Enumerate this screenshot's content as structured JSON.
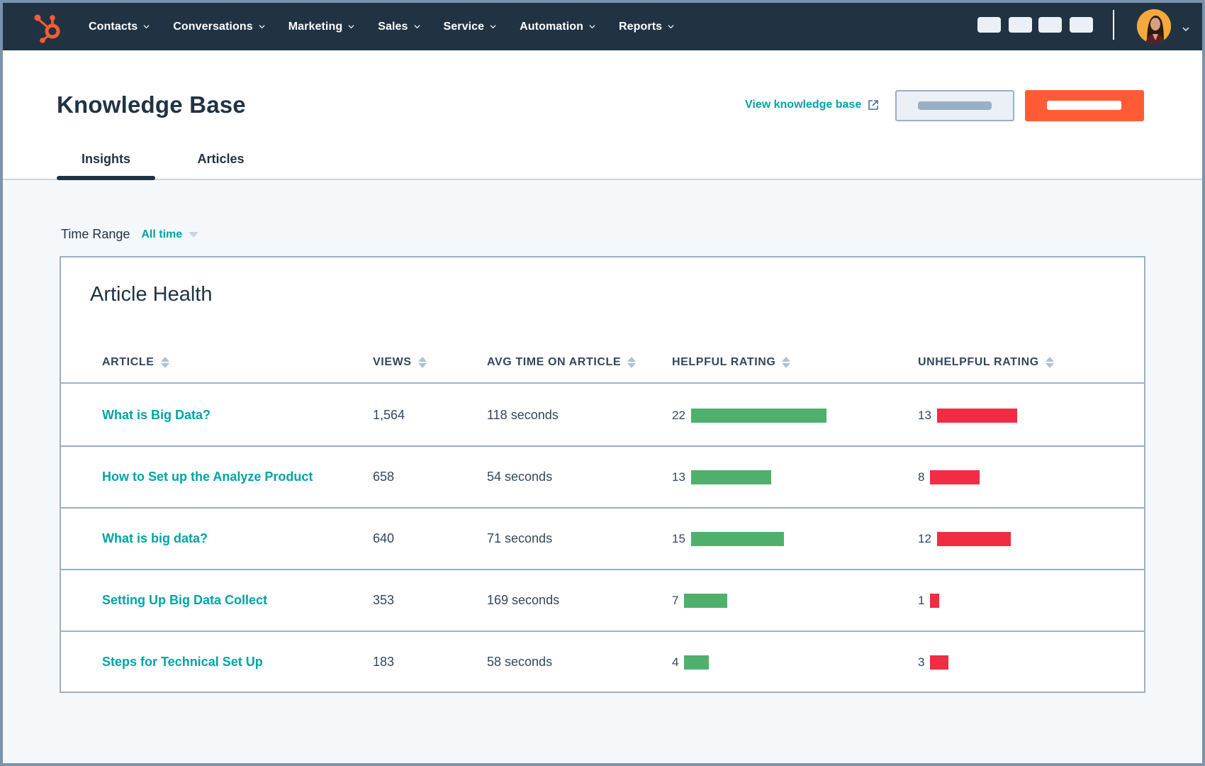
{
  "nav": {
    "logo": "hubspot-sprocket-logo",
    "items": [
      {
        "label": "Contacts"
      },
      {
        "label": "Conversations"
      },
      {
        "label": "Marketing"
      },
      {
        "label": "Sales"
      },
      {
        "label": "Service"
      },
      {
        "label": "Automation"
      },
      {
        "label": "Reports"
      }
    ],
    "avatar": "user-avatar"
  },
  "header": {
    "title": "Knowledge Base",
    "view_link": "View knowledge base",
    "tabs": [
      {
        "label": "Insights",
        "active": true
      },
      {
        "label": "Articles",
        "active": false
      }
    ]
  },
  "filters": {
    "time_range_label": "Time Range",
    "time_range_value": "All time"
  },
  "card": {
    "title": "Article Health",
    "columns": [
      "ARTICLE",
      "VIEWS",
      "AVG TIME ON ARTICLE",
      "HELPFUL RATING",
      "UNHELPFUL RATING"
    ],
    "rows": [
      {
        "article": "What is Big Data?",
        "views": "1,564",
        "avg_time": "118 seconds",
        "helpful": 22,
        "unhelpful": 13
      },
      {
        "article": "How to Set up the Analyze Product",
        "views": "658",
        "avg_time": "54 seconds",
        "helpful": 13,
        "unhelpful": 8
      },
      {
        "article": "What is big data?",
        "views": "640",
        "avg_time": "71 seconds",
        "helpful": 15,
        "unhelpful": 12
      },
      {
        "article": "Setting Up Big Data Collect",
        "views": "353",
        "avg_time": "169 seconds",
        "helpful": 7,
        "unhelpful": 1
      },
      {
        "article": "Steps for Technical Set Up",
        "views": "183",
        "avg_time": "58 seconds",
        "helpful": 4,
        "unhelpful": 3
      }
    ]
  },
  "colors": {
    "nav_bg": "#213343",
    "accent_teal": "#00a4a6",
    "primary_orange": "#ff5c35",
    "helpful_green": "#4fb06d",
    "unhelpful_red": "#f02d43"
  }
}
